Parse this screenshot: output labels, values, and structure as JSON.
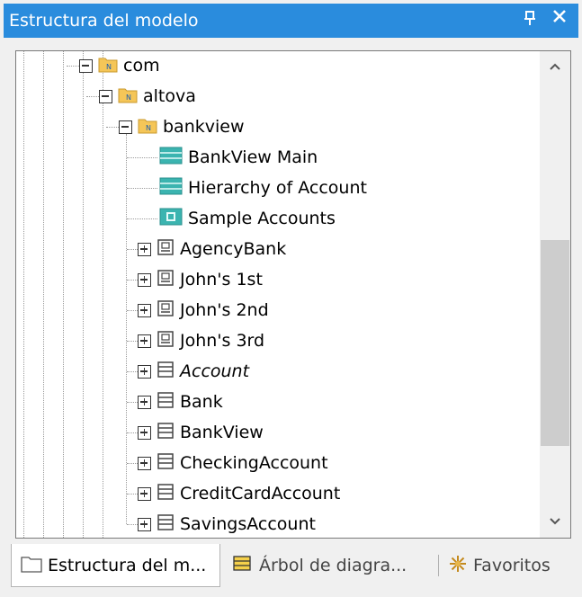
{
  "panel": {
    "title": "Estructura del modelo",
    "pin_icon": "pin-icon",
    "close_icon": "close-icon"
  },
  "tree": {
    "nodes": [
      {
        "label": "com",
        "icon": "package-icon",
        "expander": "collapse"
      },
      {
        "label": "altova",
        "icon": "package-icon",
        "expander": "collapse"
      },
      {
        "label": "bankview",
        "icon": "package-icon",
        "expander": "collapse"
      },
      {
        "label": "BankView Main",
        "icon": "class-diagram-icon"
      },
      {
        "label": "Hierarchy of Account",
        "icon": "class-diagram-icon"
      },
      {
        "label": "Sample Accounts",
        "icon": "object-diagram-icon"
      },
      {
        "label": "AgencyBank",
        "icon": "instance-icon",
        "expander": "expand"
      },
      {
        "label": "John's 1st",
        "icon": "instance-icon",
        "expander": "expand"
      },
      {
        "label": "John's 2nd",
        "icon": "instance-icon",
        "expander": "expand"
      },
      {
        "label": "John's 3rd",
        "icon": "instance-icon",
        "expander": "expand"
      },
      {
        "label": "Account",
        "icon": "class-icon",
        "expander": "expand",
        "italic": true
      },
      {
        "label": "Bank",
        "icon": "class-icon",
        "expander": "expand"
      },
      {
        "label": "BankView",
        "icon": "class-icon",
        "expander": "expand"
      },
      {
        "label": "CheckingAccount",
        "icon": "class-icon",
        "expander": "expand"
      },
      {
        "label": "CreditCardAccount",
        "icon": "class-icon",
        "expander": "expand"
      },
      {
        "label": "SavingsAccount",
        "icon": "class-icon",
        "expander": "expand"
      }
    ]
  },
  "tabs": [
    {
      "label": "Estructura del m...",
      "icon": "folder-icon",
      "active": true
    },
    {
      "label": "Árbol de diagra...",
      "icon": "diagram-tree-icon",
      "active": false
    },
    {
      "label": "Favoritos",
      "icon": "favorites-icon",
      "active": false
    }
  ],
  "colors": {
    "title_bar": "#2a8cdd",
    "package_folder": "#f5c658",
    "diagram_teal": "#3bb4b0"
  }
}
